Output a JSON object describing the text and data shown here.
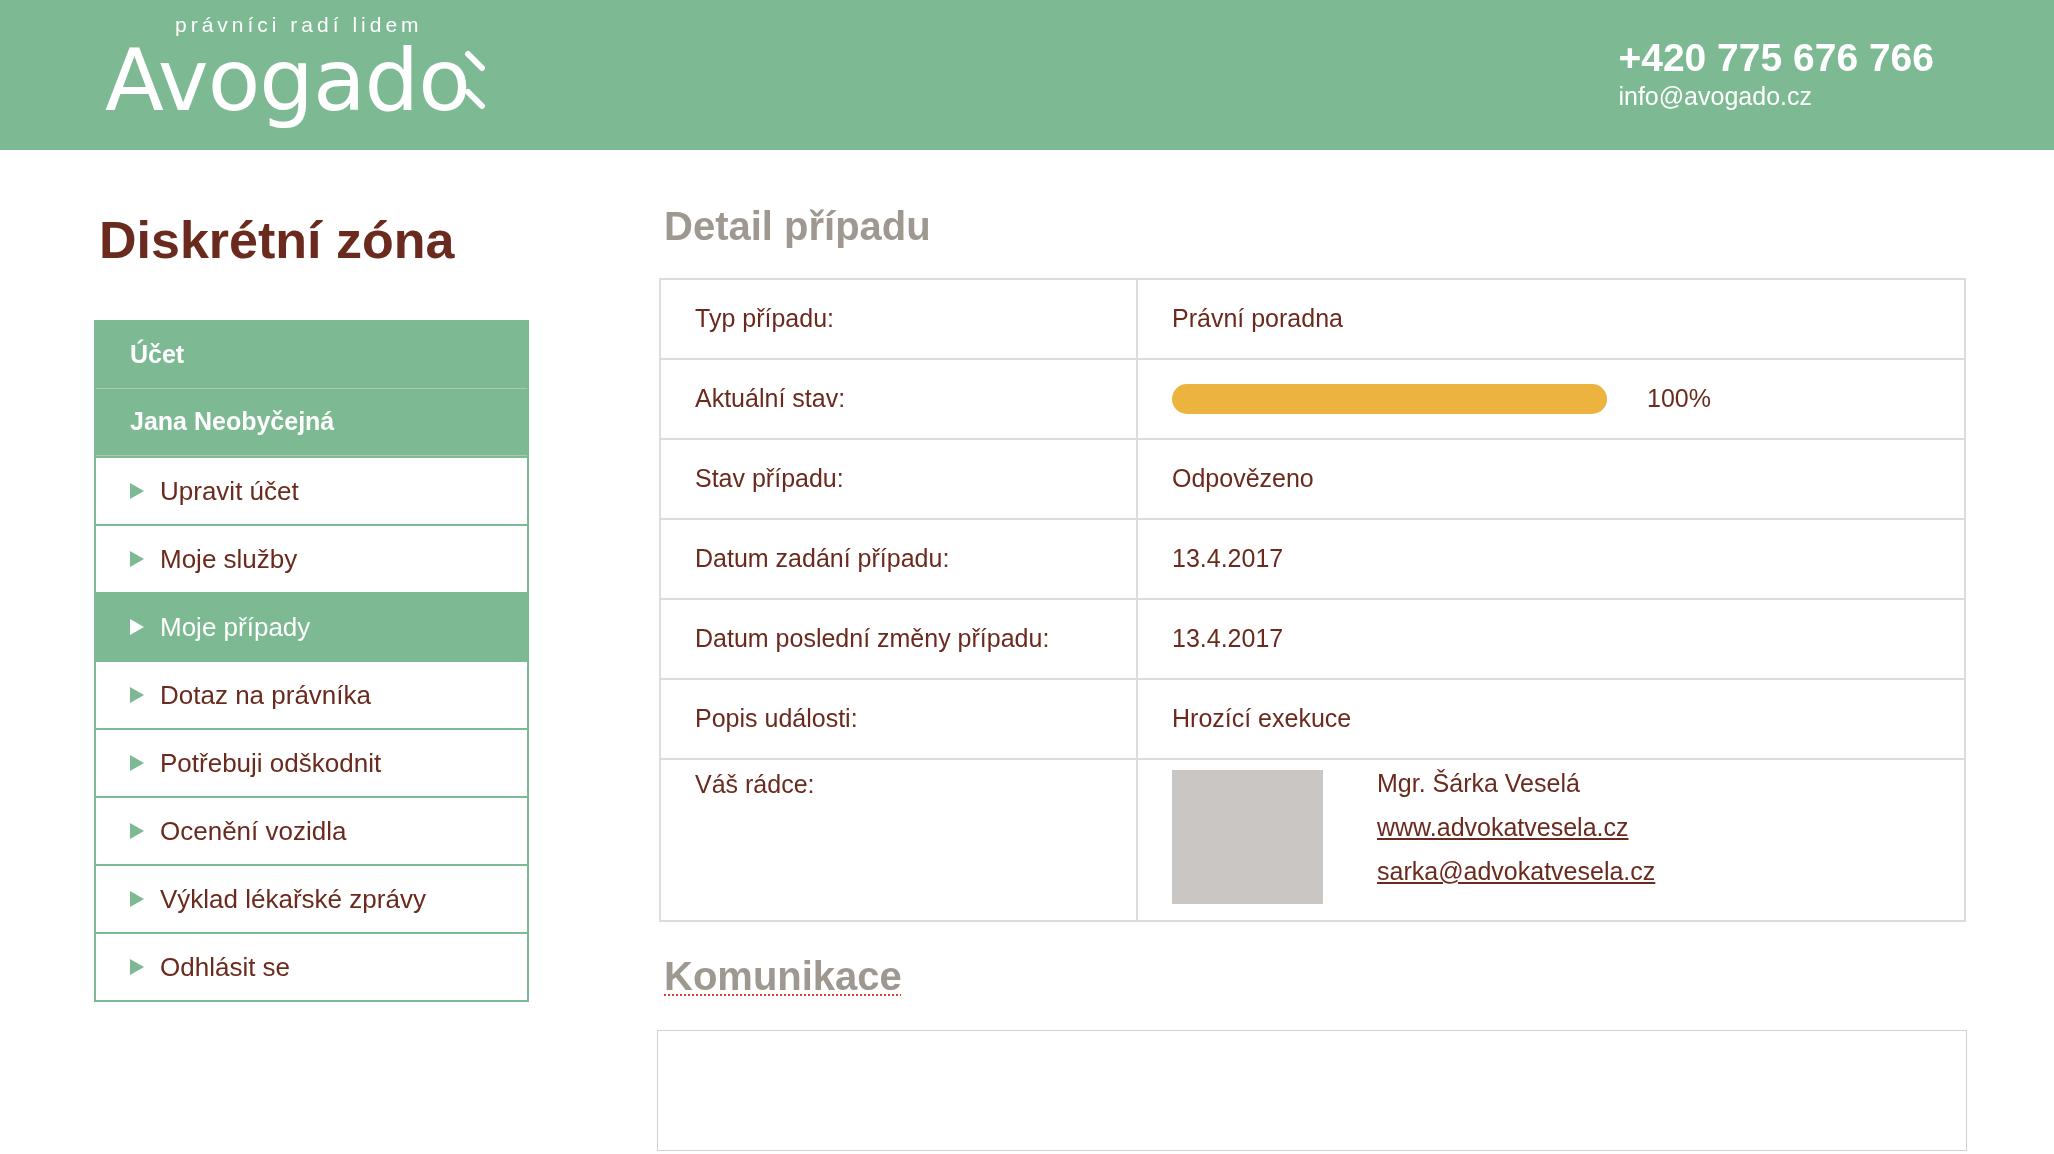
{
  "header": {
    "logo": {
      "tagline": "právníci radí lidem",
      "wordmark": "Avogado"
    },
    "phone": "+420 775 676 766",
    "email": "info@avogado.cz"
  },
  "sidebar": {
    "title": "Diskrétní zóna",
    "items": [
      {
        "kind": "heading",
        "label": "Účet",
        "selected": false
      },
      {
        "kind": "heading",
        "label": "Jana Neobyčejná",
        "selected": false
      },
      {
        "kind": "link",
        "label": "Upravit účet",
        "selected": false
      },
      {
        "kind": "link",
        "label": "Moje služby",
        "selected": false
      },
      {
        "kind": "link",
        "label": "Moje případy",
        "selected": true
      },
      {
        "kind": "link",
        "label": "Dotaz na právníka",
        "selected": false
      },
      {
        "kind": "link",
        "label": "Potřebuji odškodnit",
        "selected": false
      },
      {
        "kind": "link",
        "label": "Ocenění vozidla",
        "selected": false
      },
      {
        "kind": "link",
        "label": "Výklad lékařské zprávy",
        "selected": false
      },
      {
        "kind": "link",
        "label": "Odhlásit se",
        "selected": false
      }
    ]
  },
  "detail": {
    "title": "Detail případu",
    "rows": [
      {
        "kind": "text",
        "label": "Typ případu:",
        "value": "Právní poradna"
      },
      {
        "kind": "progress",
        "label": "Aktuální stav:",
        "level": 1.0,
        "reading": "100%"
      },
      {
        "kind": "text",
        "label": "Stav případu:",
        "value": "Odpovězeno"
      },
      {
        "kind": "text",
        "label": "Datum zadání případu:",
        "value": "13.4.2017"
      },
      {
        "kind": "text",
        "label": "Datum poslední změny případu:",
        "value": "13.4.2017"
      },
      {
        "kind": "text",
        "label": "Popis události:",
        "value": "Hrozící exekuce"
      },
      {
        "kind": "advisor",
        "label": "Váš rádce:",
        "name": "Mgr. Šárka Veselá",
        "website": "www.advokatvesela.cz",
        "email": "sarka@advokatvesela.cz"
      }
    ]
  },
  "communication": {
    "title": "Komunikace"
  }
}
